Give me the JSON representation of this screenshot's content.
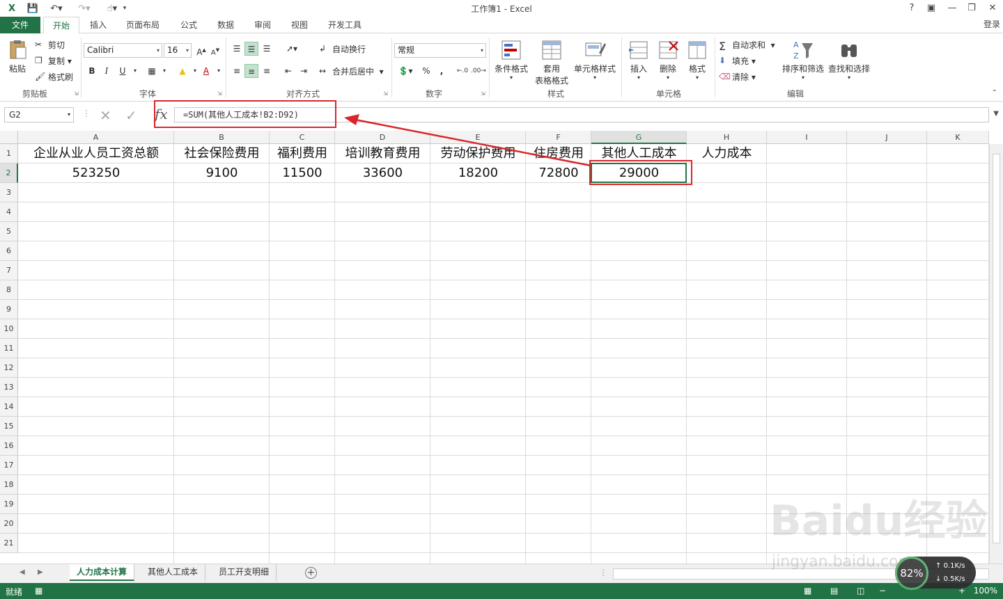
{
  "window": {
    "title": "工作簿1 - Excel",
    "help": "?",
    "login": "登录"
  },
  "tabs": [
    "文件",
    "开始",
    "插入",
    "页面布局",
    "公式",
    "数据",
    "审阅",
    "视图",
    "开发工具"
  ],
  "ribbon": {
    "clipboard": {
      "paste": "粘贴",
      "cut": "剪切",
      "copy": "复制",
      "format_painter": "格式刷",
      "label": "剪贴板"
    },
    "font": {
      "name": "Calibri",
      "size": "16",
      "bold": "B",
      "italic": "I",
      "underline": "U",
      "label": "字体"
    },
    "alignment": {
      "wrap": "自动换行",
      "merge": "合并后居中",
      "label": "对齐方式"
    },
    "number": {
      "format": "常规",
      "percent": "%",
      "comma": ",",
      "label": "数字"
    },
    "styles": {
      "conditional": "条件格式",
      "table_line1": "套用",
      "table_line2": "表格格式",
      "cell_styles": "单元格样式",
      "label": "样式"
    },
    "cells": {
      "insert": "插入",
      "delete": "删除",
      "format": "格式",
      "label": "单元格"
    },
    "editing": {
      "autosum": "自动求和",
      "fill": "填充",
      "clear": "清除",
      "sort": "排序和筛选",
      "find": "查找和选择",
      "label": "编辑"
    }
  },
  "formula_bar": {
    "name_box": "G2",
    "fx": "fx",
    "formula": "=SUM(其他人工成本!B2:D92)"
  },
  "columns": [
    "A",
    "B",
    "C",
    "D",
    "E",
    "F",
    "G",
    "H",
    "I",
    "J",
    "K"
  ],
  "rows": [
    "1",
    "2",
    "3",
    "4",
    "5",
    "6",
    "7",
    "8",
    "9",
    "10",
    "11",
    "12",
    "13",
    "14",
    "15",
    "16",
    "17",
    "18",
    "19",
    "20",
    "21"
  ],
  "cells": {
    "row1": [
      "企业从业人员工资总额",
      "社会保险费用",
      "福利费用",
      "培训教育费用",
      "劳动保护费用",
      "住房费用",
      "其他人工成本",
      "人力成本"
    ],
    "row2": [
      "523250",
      "9100",
      "11500",
      "33600",
      "18200",
      "72800",
      "29000"
    ]
  },
  "sheet_tabs": [
    "人力成本计算",
    "其他人工成本",
    "员工开支明细"
  ],
  "status": {
    "ready": "就绪",
    "zoom": "100%"
  },
  "net_widget": {
    "percent": "82%",
    "up": "0.1K/s",
    "down": "0.5K/s"
  },
  "watermark": {
    "text": "Baidu经验",
    "url": "jingyan.baidu.com"
  },
  "colors": {
    "accent": "#217346",
    "highlight": "#d9262b"
  }
}
